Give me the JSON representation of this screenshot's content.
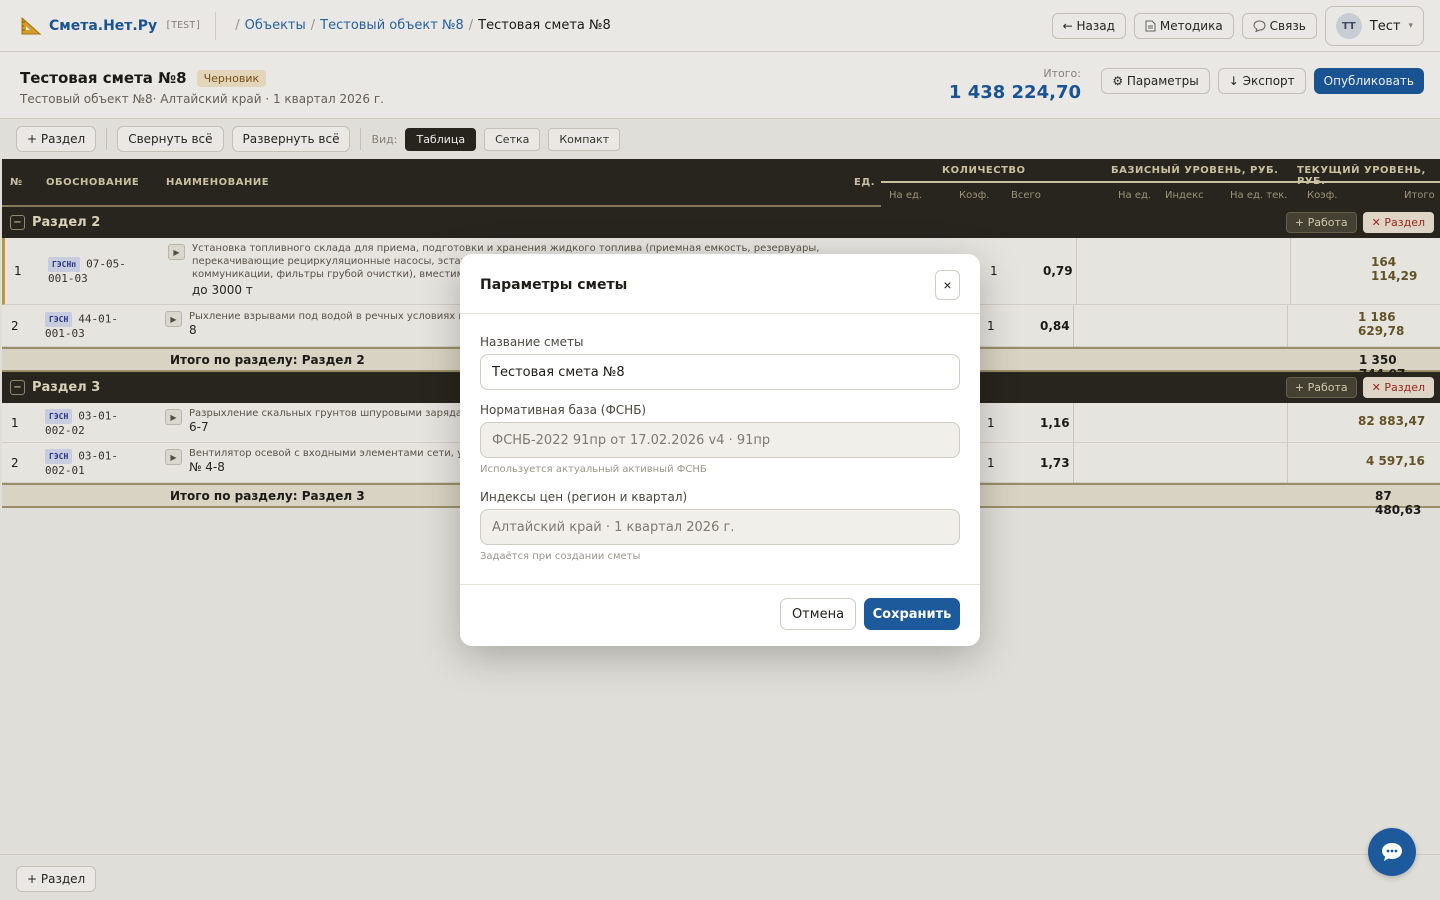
{
  "app": {
    "name": "Смета.Нет.Ру",
    "env": "[TEST]"
  },
  "breadcrumb": {
    "items": [
      {
        "label": "Объекты"
      },
      {
        "label": "Тестовый объект №8"
      },
      {
        "label": "Тестовая смета №8"
      }
    ],
    "separator": "/"
  },
  "top_actions": {
    "back": "← Назад",
    "method": "Методика",
    "contact": "Связь"
  },
  "user": {
    "initials": "ТТ",
    "name": "Тест",
    "caret": "▾"
  },
  "header": {
    "title": "Тестовая смета №8",
    "status": "Черновик",
    "subtitle": "Тестовый объект №8· Алтайский край · 1 квартал 2026 г.",
    "total_label": "Итого:",
    "total_value": "1 438 224,70",
    "params": "⚙ Параметры",
    "export": "↓ Экспорт",
    "publish": "Опубликовать"
  },
  "toolbar": {
    "add_section": "+ Раздел",
    "collapse_all": "Свернуть всё",
    "expand_all": "Развернуть всё",
    "view_label": "Вид:",
    "view_table": "Таблица",
    "view_grid": "Сетка",
    "view_compact": "Компакт"
  },
  "table": {
    "columns": {
      "num": "№",
      "basis": "ОБОСНОВАНИЕ",
      "name": "НАИМЕНОВАНИЕ",
      "unit": "ЕД.",
      "qty": "КОЛИЧЕСТВО",
      "base": "БАЗИСНЫЙ УРОВЕНЬ, РУБ.",
      "current": "ТЕКУЩИЙ УРОВЕНЬ, РУБ."
    },
    "subcolumns": {
      "qty_per": "На ед.",
      "qty_coef": "Коэф.",
      "qty_total": "Всего",
      "base_per": "На ед.",
      "base_index": "Индекс",
      "base_per_cur": "На ед. тек.",
      "cur_coef": "Коэф.",
      "cur_total": "Итого"
    },
    "section_add_work": "+ Работа",
    "section_remove": "✕ Раздел",
    "sections": [
      {
        "title": "Раздел 2",
        "subtotal_label": "Итого по разделу: Раздел 2",
        "subtotal": "1 350 744,07",
        "rows": [
          {
            "num": "1",
            "tag": "ГЭСНп",
            "code1": "07-05-",
            "code2": "001-03",
            "name_small": "Установка топливного склада для приема, подготовки и хранения жидкого топлива (приемная емкость, резервуары, перекачивающие рециркуляционные насосы, эстакад",
            "name_small_2": "коммуникации, фильтры грубой очистки), вместимост",
            "name_big": "до 3000 т",
            "coef": "1",
            "total": "0,79",
            "amount": "164 114,29"
          },
          {
            "num": "2",
            "tag": "ГЭСН",
            "code1": "44-01-",
            "code2": "001-03",
            "name_small": "Рыхление взрывами под водой в речных условиях гру",
            "name_big": "8",
            "coef": "1",
            "total": "0,84",
            "amount": "1 186 629,78"
          }
        ]
      },
      {
        "title": "Раздел 3",
        "subtotal_label": "Итого по разделу: Раздел 3",
        "subtotal": "87 480,63",
        "rows": [
          {
            "num": "1",
            "tag": "ГЭСН",
            "code1": "03-01-",
            "code2": "002-02",
            "name_small": "Разрыхление скальных грунтов шпуровыми зарядами",
            "name_big": "6-7",
            "coef": "1",
            "total": "1,16",
            "amount": "82 883,47"
          },
          {
            "num": "2",
            "tag": "ГЭСН",
            "code1": "03-01-",
            "code2": "002-01",
            "name_small": "Вентилятор осевой с входными элементами сети, уста",
            "name_big": "№ 4-8",
            "coef": "1",
            "total": "1,73",
            "amount": "4 597,16"
          }
        ]
      }
    ]
  },
  "footer": {
    "add_section": "+ Раздел"
  },
  "modal": {
    "title": "Параметры сметы",
    "close": "×",
    "name_label": "Название сметы",
    "name_value": "Тестовая смета №8",
    "base_label": "Нормативная база (ФСНБ)",
    "base_value": "ФСНБ-2022 91пр от 17.02.2026 v4 · 91пр",
    "base_hint": "Используется актуальный активный ФСНБ",
    "index_label": "Индексы цен (регион и квартал)",
    "index_value": "Алтайский край · 1 квартал 2026 г.",
    "index_hint": "Задаётся при создании сметы",
    "cancel": "Отмена",
    "save": "Сохранить"
  },
  "colors": {
    "primary": "#1d5a9c",
    "dark_header": "#2b2820",
    "draft_badge": "#f4e6c8"
  },
  "icons": {
    "logo": "ruler-triangle-icon",
    "method": "document-icon",
    "contact": "chat-bubble-icon",
    "fab": "chat-icon"
  }
}
